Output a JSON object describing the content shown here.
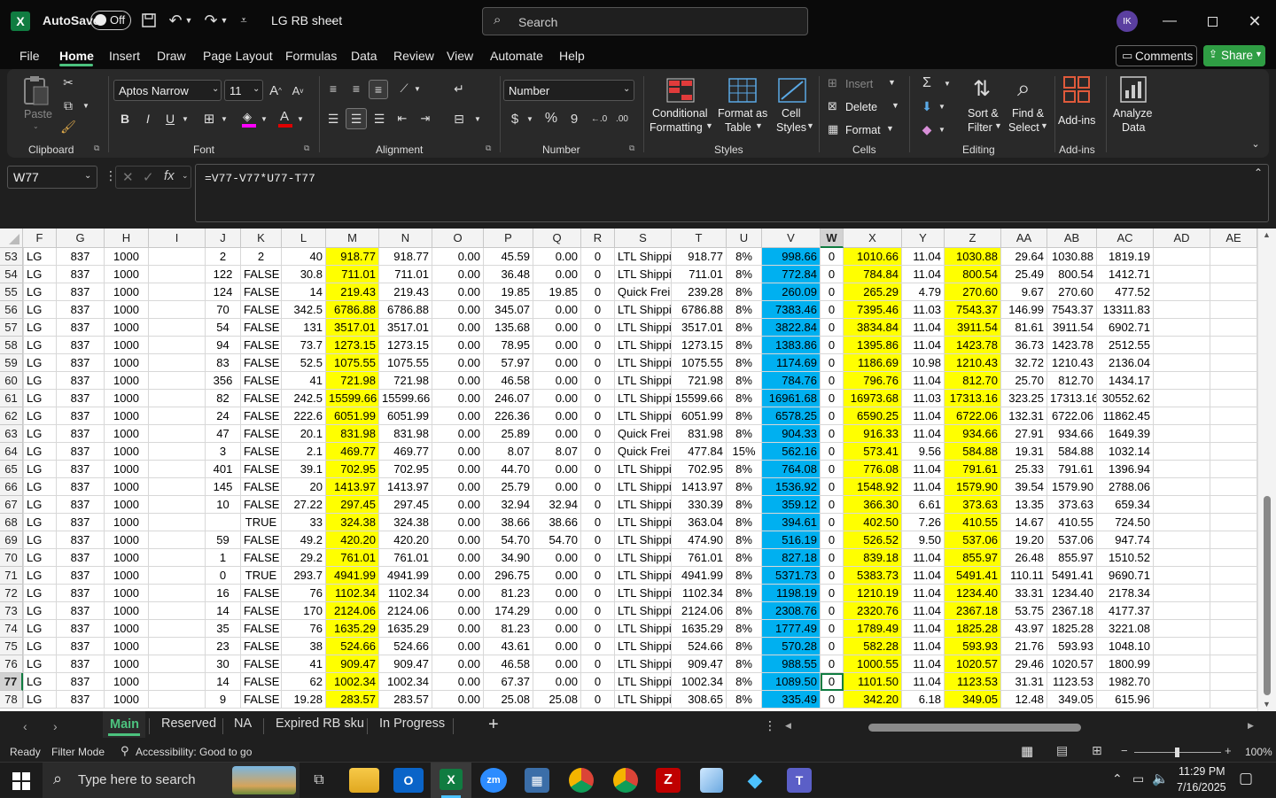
{
  "title_bar": {
    "autosave_label": "AutoSave",
    "autosave_state": "Off",
    "filename": "LG RB sheet",
    "search_placeholder": "Search",
    "avatar_initials": "IK"
  },
  "menu": [
    "File",
    "Home",
    "Insert",
    "Draw",
    "Page Layout",
    "Formulas",
    "Data",
    "Review",
    "View",
    "Automate",
    "Help"
  ],
  "menu_active": "Home",
  "comments_label": "Comments",
  "share_label": "Share",
  "ribbon": {
    "clipboard": {
      "paste": "Paste",
      "label": "Clipboard"
    },
    "font": {
      "family": "Aptos Narrow",
      "size": "11",
      "label": "Font"
    },
    "alignment": {
      "label": "Alignment"
    },
    "number": {
      "format": "Number",
      "label": "Number",
      "percent": "%",
      "comma": "9",
      "dollar": "$"
    },
    "styles": {
      "conditional": "Conditional",
      "conditional2": "Formatting",
      "format_as": "Format as",
      "format_as2": "Table",
      "cell": "Cell",
      "cell2": "Styles",
      "label": "Styles"
    },
    "cells": {
      "insert": "Insert",
      "delete": "Delete",
      "format": "Format",
      "label": "Cells"
    },
    "editing": {
      "sort": "Sort &",
      "sort2": "Filter",
      "find": "Find &",
      "find2": "Select",
      "label": "Editing"
    },
    "addins": {
      "addins": "Add-ins",
      "label": "Add-ins"
    },
    "analyze": {
      "line1": "Analyze",
      "line2": "Data"
    }
  },
  "formula_bar": {
    "name_box": "W77",
    "fx": "fx",
    "formula": "=V77-V77*U77-T77"
  },
  "columns": [
    "F",
    "G",
    "H",
    "I",
    "J",
    "K",
    "L",
    "M",
    "N",
    "O",
    "P",
    "Q",
    "R",
    "S",
    "T",
    "U",
    "V",
    "W",
    "X",
    "Y",
    "Z",
    "AA",
    "AB",
    "AC",
    "AD",
    "AE"
  ],
  "rows": [
    {
      "n": "53",
      "F": "LG",
      "G": "837",
      "H": "1000",
      "J": "2",
      "K": "2",
      "L": "40",
      "M": "918.77",
      "N": "918.77",
      "O": "0.00",
      "P": "45.59",
      "Q": "0.00",
      "R": "0",
      "S": "LTL Shippi",
      "T": "918.77",
      "U": "8%",
      "V": "998.66",
      "W": "0",
      "X": "1010.66",
      "Y": "11.04",
      "Z": "1030.88",
      "AA": "29.64",
      "AB": "1030.88",
      "AC": "1819.19"
    },
    {
      "n": "54",
      "F": "LG",
      "G": "837",
      "H": "1000",
      "J": "122",
      "K": "FALSE",
      "L": "30.8",
      "M": "711.01",
      "N": "711.01",
      "O": "0.00",
      "P": "36.48",
      "Q": "0.00",
      "R": "0",
      "S": "LTL Shippi",
      "T": "711.01",
      "U": "8%",
      "V": "772.84",
      "W": "0",
      "X": "784.84",
      "Y": "11.04",
      "Z": "800.54",
      "AA": "25.49",
      "AB": "800.54",
      "AC": "1412.71"
    },
    {
      "n": "55",
      "F": "LG",
      "G": "837",
      "H": "1000",
      "J": "124",
      "K": "FALSE",
      "L": "14",
      "M": "219.43",
      "N": "219.43",
      "O": "0.00",
      "P": "19.85",
      "Q": "19.85",
      "R": "0",
      "S": "Quick Frei",
      "T": "239.28",
      "U": "8%",
      "V": "260.09",
      "W": "0",
      "X": "265.29",
      "Y": "4.79",
      "Z": "270.60",
      "AA": "9.67",
      "AB": "270.60",
      "AC": "477.52"
    },
    {
      "n": "56",
      "F": "LG",
      "G": "837",
      "H": "1000",
      "J": "70",
      "K": "FALSE",
      "L": "342.5",
      "M": "6786.88",
      "N": "6786.88",
      "O": "0.00",
      "P": "345.07",
      "Q": "0.00",
      "R": "0",
      "S": "LTL Shippi",
      "T": "6786.88",
      "U": "8%",
      "V": "7383.46",
      "W": "0",
      "X": "7395.46",
      "Y": "11.03",
      "Z": "7543.37",
      "AA": "146.99",
      "AB": "7543.37",
      "AC": "13311.83"
    },
    {
      "n": "57",
      "F": "LG",
      "G": "837",
      "H": "1000",
      "J": "54",
      "K": "FALSE",
      "L": "131",
      "M": "3517.01",
      "N": "3517.01",
      "O": "0.00",
      "P": "135.68",
      "Q": "0.00",
      "R": "0",
      "S": "LTL Shippi",
      "T": "3517.01",
      "U": "8%",
      "V": "3822.84",
      "W": "0",
      "X": "3834.84",
      "Y": "11.04",
      "Z": "3911.54",
      "AA": "81.61",
      "AB": "3911.54",
      "AC": "6902.71"
    },
    {
      "n": "58",
      "F": "LG",
      "G": "837",
      "H": "1000",
      "J": "94",
      "K": "FALSE",
      "L": "73.7",
      "M": "1273.15",
      "N": "1273.15",
      "O": "0.00",
      "P": "78.95",
      "Q": "0.00",
      "R": "0",
      "S": "LTL Shippi",
      "T": "1273.15",
      "U": "8%",
      "V": "1383.86",
      "W": "0",
      "X": "1395.86",
      "Y": "11.04",
      "Z": "1423.78",
      "AA": "36.73",
      "AB": "1423.78",
      "AC": "2512.55"
    },
    {
      "n": "59",
      "F": "LG",
      "G": "837",
      "H": "1000",
      "J": "83",
      "K": "FALSE",
      "L": "52.5",
      "M": "1075.55",
      "N": "1075.55",
      "O": "0.00",
      "P": "57.97",
      "Q": "0.00",
      "R": "0",
      "S": "LTL Shippi",
      "T": "1075.55",
      "U": "8%",
      "V": "1174.69",
      "W": "0",
      "X": "1186.69",
      "Y": "10.98",
      "Z": "1210.43",
      "AA": "32.72",
      "AB": "1210.43",
      "AC": "2136.04"
    },
    {
      "n": "60",
      "F": "LG",
      "G": "837",
      "H": "1000",
      "J": "356",
      "K": "FALSE",
      "L": "41",
      "M": "721.98",
      "N": "721.98",
      "O": "0.00",
      "P": "46.58",
      "Q": "0.00",
      "R": "0",
      "S": "LTL Shippi",
      "T": "721.98",
      "U": "8%",
      "V": "784.76",
      "W": "0",
      "X": "796.76",
      "Y": "11.04",
      "Z": "812.70",
      "AA": "25.70",
      "AB": "812.70",
      "AC": "1434.17"
    },
    {
      "n": "61",
      "F": "LG",
      "G": "837",
      "H": "1000",
      "J": "82",
      "K": "FALSE",
      "L": "242.5",
      "M": "15599.66",
      "N": "15599.66",
      "O": "0.00",
      "P": "246.07",
      "Q": "0.00",
      "R": "0",
      "S": "LTL Shippi",
      "T": "15599.66",
      "U": "8%",
      "V": "16961.68",
      "W": "0",
      "X": "16973.68",
      "Y": "11.03",
      "Z": "17313.16",
      "AA": "323.25",
      "AB": "17313.16",
      "AC": "30552.62"
    },
    {
      "n": "62",
      "F": "LG",
      "G": "837",
      "H": "1000",
      "J": "24",
      "K": "FALSE",
      "L": "222.6",
      "M": "6051.99",
      "N": "6051.99",
      "O": "0.00",
      "P": "226.36",
      "Q": "0.00",
      "R": "0",
      "S": "LTL Shippi",
      "T": "6051.99",
      "U": "8%",
      "V": "6578.25",
      "W": "0",
      "X": "6590.25",
      "Y": "11.04",
      "Z": "6722.06",
      "AA": "132.31",
      "AB": "6722.06",
      "AC": "11862.45"
    },
    {
      "n": "63",
      "F": "LG",
      "G": "837",
      "H": "1000",
      "J": "47",
      "K": "FALSE",
      "L": "20.1",
      "M": "831.98",
      "N": "831.98",
      "O": "0.00",
      "P": "25.89",
      "Q": "0.00",
      "R": "0",
      "S": "Quick Frei",
      "T": "831.98",
      "U": "8%",
      "V": "904.33",
      "W": "0",
      "X": "916.33",
      "Y": "11.04",
      "Z": "934.66",
      "AA": "27.91",
      "AB": "934.66",
      "AC": "1649.39"
    },
    {
      "n": "64",
      "F": "LG",
      "G": "837",
      "H": "1000",
      "J": "3",
      "K": "FALSE",
      "L": "2.1",
      "M": "469.77",
      "N": "469.77",
      "O": "0.00",
      "P": "8.07",
      "Q": "8.07",
      "R": "0",
      "S": "Quick Frei",
      "T": "477.84",
      "U": "15%",
      "V": "562.16",
      "W": "0",
      "X": "573.41",
      "Y": "9.56",
      "Z": "584.88",
      "AA": "19.31",
      "AB": "584.88",
      "AC": "1032.14"
    },
    {
      "n": "65",
      "F": "LG",
      "G": "837",
      "H": "1000",
      "J": "401",
      "K": "FALSE",
      "L": "39.1",
      "M": "702.95",
      "N": "702.95",
      "O": "0.00",
      "P": "44.70",
      "Q": "0.00",
      "R": "0",
      "S": "LTL Shippi",
      "T": "702.95",
      "U": "8%",
      "V": "764.08",
      "W": "0",
      "X": "776.08",
      "Y": "11.04",
      "Z": "791.61",
      "AA": "25.33",
      "AB": "791.61",
      "AC": "1396.94"
    },
    {
      "n": "66",
      "F": "LG",
      "G": "837",
      "H": "1000",
      "J": "145",
      "K": "FALSE",
      "L": "20",
      "M": "1413.97",
      "N": "1413.97",
      "O": "0.00",
      "P": "25.79",
      "Q": "0.00",
      "R": "0",
      "S": "LTL Shippi",
      "T": "1413.97",
      "U": "8%",
      "V": "1536.92",
      "W": "0",
      "X": "1548.92",
      "Y": "11.04",
      "Z": "1579.90",
      "AA": "39.54",
      "AB": "1579.90",
      "AC": "2788.06"
    },
    {
      "n": "67",
      "F": "LG",
      "G": "837",
      "H": "1000",
      "J": "10",
      "K": "FALSE",
      "L": "27.22",
      "M": "297.45",
      "N": "297.45",
      "O": "0.00",
      "P": "32.94",
      "Q": "32.94",
      "R": "0",
      "S": "LTL Shippi",
      "T": "330.39",
      "U": "8%",
      "V": "359.12",
      "W": "0",
      "X": "366.30",
      "Y": "6.61",
      "Z": "373.63",
      "AA": "13.35",
      "AB": "373.63",
      "AC": "659.34"
    },
    {
      "n": "68",
      "F": "LG",
      "G": "837",
      "H": "1000",
      "J": "",
      "K": "TRUE",
      "L": "33",
      "M": "324.38",
      "N": "324.38",
      "O": "0.00",
      "P": "38.66",
      "Q": "38.66",
      "R": "0",
      "S": "LTL Shippi",
      "T": "363.04",
      "U": "8%",
      "V": "394.61",
      "W": "0",
      "X": "402.50",
      "Y": "7.26",
      "Z": "410.55",
      "AA": "14.67",
      "AB": "410.55",
      "AC": "724.50"
    },
    {
      "n": "69",
      "F": "LG",
      "G": "837",
      "H": "1000",
      "J": "59",
      "K": "FALSE",
      "L": "49.2",
      "M": "420.20",
      "N": "420.20",
      "O": "0.00",
      "P": "54.70",
      "Q": "54.70",
      "R": "0",
      "S": "LTL Shippi",
      "T": "474.90",
      "U": "8%",
      "V": "516.19",
      "W": "0",
      "X": "526.52",
      "Y": "9.50",
      "Z": "537.06",
      "AA": "19.20",
      "AB": "537.06",
      "AC": "947.74"
    },
    {
      "n": "70",
      "F": "LG",
      "G": "837",
      "H": "1000",
      "J": "1",
      "K": "FALSE",
      "L": "29.2",
      "M": "761.01",
      "N": "761.01",
      "O": "0.00",
      "P": "34.90",
      "Q": "0.00",
      "R": "0",
      "S": "LTL Shippi",
      "T": "761.01",
      "U": "8%",
      "V": "827.18",
      "W": "0",
      "X": "839.18",
      "Y": "11.04",
      "Z": "855.97",
      "AA": "26.48",
      "AB": "855.97",
      "AC": "1510.52"
    },
    {
      "n": "71",
      "F": "LG",
      "G": "837",
      "H": "1000",
      "J": "0",
      "K": "TRUE",
      "L": "293.7",
      "M": "4941.99",
      "N": "4941.99",
      "O": "0.00",
      "P": "296.75",
      "Q": "0.00",
      "R": "0",
      "S": "LTL Shippi",
      "T": "4941.99",
      "U": "8%",
      "V": "5371.73",
      "W": "0",
      "X": "5383.73",
      "Y": "11.04",
      "Z": "5491.41",
      "AA": "110.11",
      "AB": "5491.41",
      "AC": "9690.71"
    },
    {
      "n": "72",
      "F": "LG",
      "G": "837",
      "H": "1000",
      "J": "16",
      "K": "FALSE",
      "L": "76",
      "M": "1102.34",
      "N": "1102.34",
      "O": "0.00",
      "P": "81.23",
      "Q": "0.00",
      "R": "0",
      "S": "LTL Shippi",
      "T": "1102.34",
      "U": "8%",
      "V": "1198.19",
      "W": "0",
      "X": "1210.19",
      "Y": "11.04",
      "Z": "1234.40",
      "AA": "33.31",
      "AB": "1234.40",
      "AC": "2178.34"
    },
    {
      "n": "73",
      "F": "LG",
      "G": "837",
      "H": "1000",
      "J": "14",
      "K": "FALSE",
      "L": "170",
      "M": "2124.06",
      "N": "2124.06",
      "O": "0.00",
      "P": "174.29",
      "Q": "0.00",
      "R": "0",
      "S": "LTL Shippi",
      "T": "2124.06",
      "U": "8%",
      "V": "2308.76",
      "W": "0",
      "X": "2320.76",
      "Y": "11.04",
      "Z": "2367.18",
      "AA": "53.75",
      "AB": "2367.18",
      "AC": "4177.37"
    },
    {
      "n": "74",
      "F": "LG",
      "G": "837",
      "H": "1000",
      "J": "35",
      "K": "FALSE",
      "L": "76",
      "M": "1635.29",
      "N": "1635.29",
      "O": "0.00",
      "P": "81.23",
      "Q": "0.00",
      "R": "0",
      "S": "LTL Shippi",
      "T": "1635.29",
      "U": "8%",
      "V": "1777.49",
      "W": "0",
      "X": "1789.49",
      "Y": "11.04",
      "Z": "1825.28",
      "AA": "43.97",
      "AB": "1825.28",
      "AC": "3221.08"
    },
    {
      "n": "75",
      "F": "LG",
      "G": "837",
      "H": "1000",
      "J": "23",
      "K": "FALSE",
      "L": "38",
      "M": "524.66",
      "N": "524.66",
      "O": "0.00",
      "P": "43.61",
      "Q": "0.00",
      "R": "0",
      "S": "LTL Shippi",
      "T": "524.66",
      "U": "8%",
      "V": "570.28",
      "W": "0",
      "X": "582.28",
      "Y": "11.04",
      "Z": "593.93",
      "AA": "21.76",
      "AB": "593.93",
      "AC": "1048.10"
    },
    {
      "n": "76",
      "F": "LG",
      "G": "837",
      "H": "1000",
      "J": "30",
      "K": "FALSE",
      "L": "41",
      "M": "909.47",
      "N": "909.47",
      "O": "0.00",
      "P": "46.58",
      "Q": "0.00",
      "R": "0",
      "S": "LTL Shippi",
      "T": "909.47",
      "U": "8%",
      "V": "988.55",
      "W": "0",
      "X": "1000.55",
      "Y": "11.04",
      "Z": "1020.57",
      "AA": "29.46",
      "AB": "1020.57",
      "AC": "1800.99"
    },
    {
      "n": "77",
      "F": "LG",
      "G": "837",
      "H": "1000",
      "J": "14",
      "K": "FALSE",
      "L": "62",
      "M": "1002.34",
      "N": "1002.34",
      "O": "0.00",
      "P": "67.37",
      "Q": "0.00",
      "R": "0",
      "S": "LTL Shippi",
      "T": "1002.34",
      "U": "8%",
      "V": "1089.50",
      "W": "0",
      "X": "1101.50",
      "Y": "11.04",
      "Z": "1123.53",
      "AA": "31.31",
      "AB": "1123.53",
      "AC": "1982.70"
    },
    {
      "n": "78",
      "F": "LG",
      "G": "837",
      "H": "1000",
      "J": "9",
      "K": "FALSE",
      "L": "19.28",
      "M": "283.57",
      "N": "283.57",
      "O": "0.00",
      "P": "25.08",
      "Q": "25.08",
      "R": "0",
      "S": "LTL Shippi",
      "T": "308.65",
      "U": "8%",
      "V": "335.49",
      "W": "0",
      "X": "342.20",
      "Y": "6.18",
      "Z": "349.05",
      "AA": "12.48",
      "AB": "349.05",
      "AC": "615.96"
    }
  ],
  "active_cell": "W77",
  "sheet_tabs": [
    "Main",
    "Reserved",
    "NA",
    "Expired RB sku",
    "In Progress"
  ],
  "active_sheet": "Main",
  "status": {
    "ready": "Ready",
    "filter": "Filter Mode",
    "accessibility": "Accessibility: Good to go",
    "zoom": "100%"
  },
  "taskbar": {
    "search_placeholder": "Type here to search",
    "time": "11:29 PM",
    "date": "7/16/2025"
  },
  "colors": {
    "yellow": "#ffff00",
    "blue": "#00b0f0",
    "green_header": "#21a366",
    "share": "#2f9e44"
  }
}
